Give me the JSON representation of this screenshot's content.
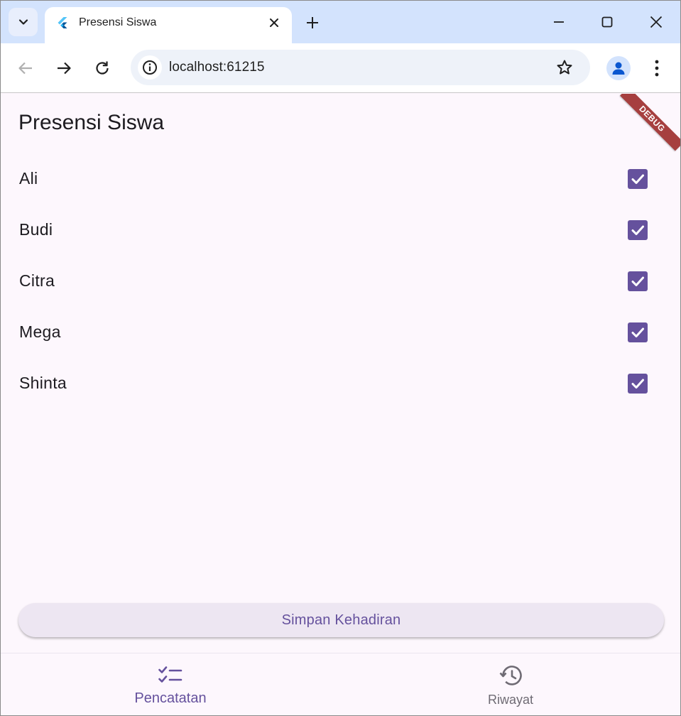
{
  "browser": {
    "tab_title": "Presensi Siswa",
    "url": "localhost:61215",
    "icons": {
      "tab_search": "chevron-down-icon",
      "favicon": "flutter-icon",
      "tab_close": "close-icon",
      "new_tab": "plus-icon",
      "minimize": "minimize-icon",
      "maximize": "maximize-icon",
      "close": "close-icon",
      "back": "arrow-left-icon",
      "forward": "arrow-right-icon",
      "reload": "reload-icon",
      "site_info": "info-icon",
      "bookmark": "star-icon",
      "profile": "person-icon",
      "menu": "more-vert-icon"
    }
  },
  "app": {
    "title": "Presensi Siswa",
    "debug_banner": "DEBUG",
    "students": [
      {
        "name": "Ali",
        "present": true
      },
      {
        "name": "Budi",
        "present": true
      },
      {
        "name": "Citra",
        "present": true
      },
      {
        "name": "Mega",
        "present": true
      },
      {
        "name": "Shinta",
        "present": true
      }
    ],
    "save_label": "Simpan Kehadiran",
    "nav": {
      "items": [
        {
          "label": "Pencatatan",
          "icon": "checklist-icon",
          "active": true
        },
        {
          "label": "Riwayat",
          "icon": "history-icon",
          "active": false
        }
      ]
    },
    "colors": {
      "primary": "#65519d",
      "background": "#fdf7fd",
      "button_bg": "#ede6f2",
      "debug": "#a63f3f"
    }
  }
}
